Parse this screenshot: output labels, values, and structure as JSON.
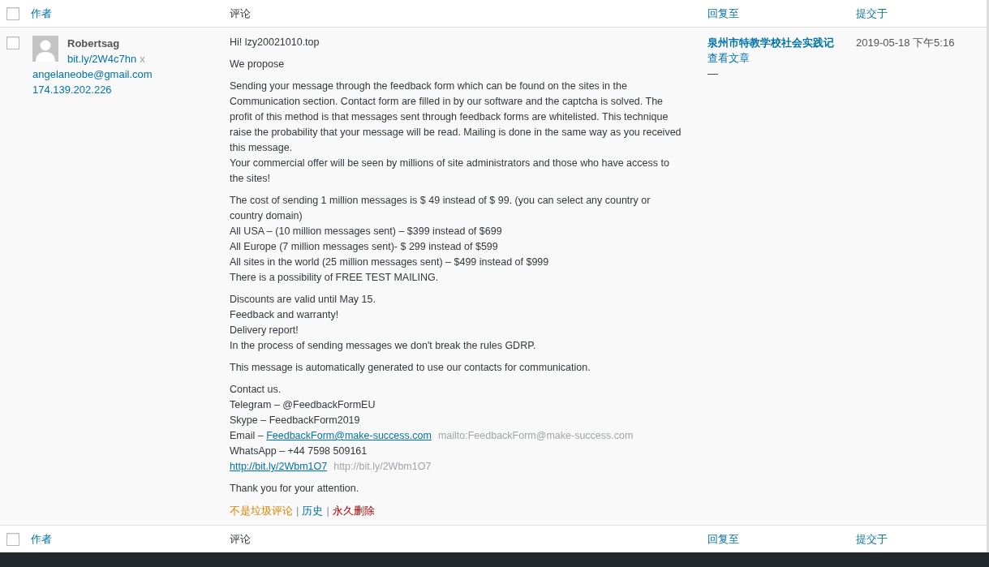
{
  "header": {
    "checked": false,
    "columns": [
      {
        "label": "作者",
        "kind": "link"
      },
      {
        "label": "评论",
        "kind": "text"
      },
      {
        "label": "回复至",
        "kind": "link"
      },
      {
        "label": "提交于",
        "kind": "link"
      }
    ]
  },
  "comment": {
    "checked": false,
    "author": {
      "name": "Robertsag",
      "url": "bit.ly/2W4c7hn",
      "url_mark": "x",
      "email": "angelaneobe@gmail.com",
      "ip": "174.139.202.226"
    },
    "paragraphs": [
      [
        "Hi! lzy20021010.top"
      ],
      [
        "We propose"
      ],
      [
        "Sending your message through the feedback form which can be found on the sites in the Communication section. Contact form are filled in by our software and the captcha is solved. The profit of this method is that messages sent through feedback forms are whitelisted. This technique raise the probability that your message will be read. Mailing is done in the same way as you received this message.",
        "Your commercial offer will be seen by millions of site administrators and those who have access to the sites!"
      ],
      [
        "The cost of sending 1 million messages is $ 49 instead of $ 99. (you can select any country or country domain)",
        "All USA – (10 million messages sent) – $399 instead of $699",
        "All Europe (7 million messages sent)- $ 299 instead of $599",
        "All sites in the world (25 million messages sent) – $499 instead of $999",
        "There is a possibility of FREE TEST MAILING."
      ],
      [
        "Discounts are valid until May 15.",
        "Feedback and warranty!",
        "Delivery report!",
        "In the process of sending messages we don't break the rules GDRP."
      ],
      [
        "This message is automatically generated to use our contacts for communication."
      ],
      [
        "Contact us.",
        "Telegram – @FeedbackFormEU",
        "Skype – FeedbackForm2019",
        [
          {
            "kind": "text",
            "text": "Email – "
          },
          {
            "kind": "link",
            "text": "FeedbackForm@make-success.com"
          },
          {
            "kind": "hint",
            "text": "mailto:FeedbackForm@make-success.com"
          }
        ],
        "WhatsApp – +44 7598 509161",
        [
          {
            "kind": "link",
            "text": "http://bit.ly/2Wbm1O7"
          },
          {
            "kind": "hint",
            "text": "http://bit.ly/2Wbm1O7"
          }
        ]
      ],
      [
        "Thank you for your attention."
      ]
    ],
    "action_separator": "|",
    "row_actions": [
      {
        "label": "不是垃圾评论",
        "kind": "approve"
      },
      {
        "label": "历史",
        "kind": "history"
      },
      {
        "label": "永久删除",
        "kind": "delete"
      }
    ],
    "reply_to": {
      "title": "泉州市特教学校社会实践记",
      "view": "查看文章",
      "dash": "—"
    },
    "submitted": "2019-05-18 下午5:16"
  },
  "footer": {
    "checked": false,
    "columns": [
      {
        "label": "作者",
        "kind": "link"
      },
      {
        "label": "评论",
        "kind": "text"
      },
      {
        "label": "回复至",
        "kind": "link"
      },
      {
        "label": "提交于",
        "kind": "link"
      }
    ]
  }
}
